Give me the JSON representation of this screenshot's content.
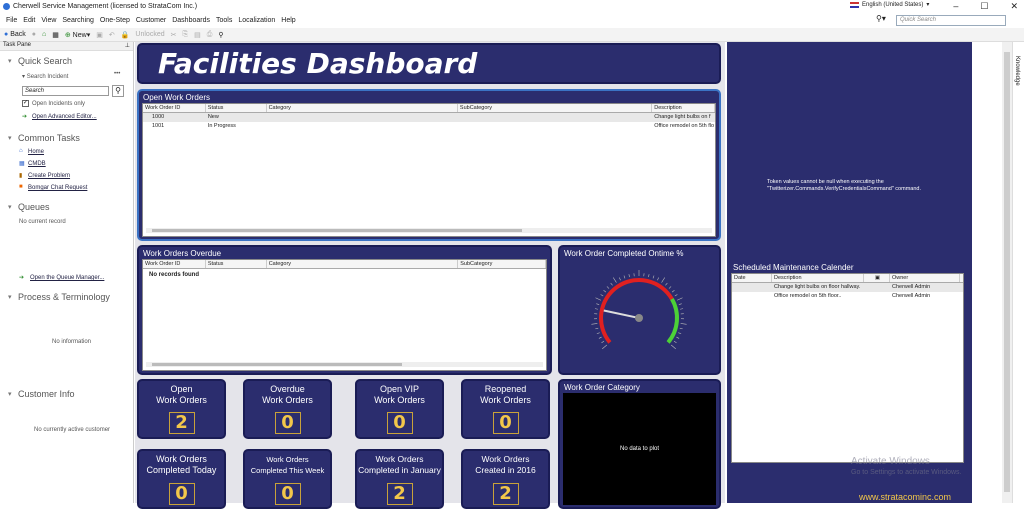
{
  "window": {
    "title": "Cherwell Service Management (licensed to StrataCom Inc.)",
    "minimize": "–",
    "maximize": "☐",
    "close": "✕",
    "language": "English (United States)"
  },
  "menu": [
    "File",
    "Edit",
    "View",
    "Searching",
    "One-Step",
    "Customer",
    "Dashboards",
    "Tools",
    "Localization",
    "Help"
  ],
  "quick_search": {
    "placeholder": "Quick Search"
  },
  "toolbar": {
    "back": "Back",
    "new": "New",
    "unlocked": "Unlocked"
  },
  "task_pane": {
    "title": "Task Pane",
    "quick_search": {
      "title": "Quick Search",
      "label": "Search Incident",
      "placeholder": "Search",
      "open_only": "Open Incidents only",
      "advanced": "Open Advanced Editor..."
    },
    "common_tasks": {
      "title": "Common Tasks",
      "items": [
        "Home",
        "CMDB",
        "Create Problem",
        "Bomgar Chat Request"
      ]
    },
    "queues": {
      "title": "Queues",
      "empty": "No current record",
      "manager": "Open the Queue Manager..."
    },
    "process": {
      "title": "Process & Terminology",
      "empty": "No information"
    },
    "customer": {
      "title": "Customer Info",
      "empty": "No currently active customer"
    }
  },
  "dashboard": {
    "title": "Facilities Dashboard",
    "open_work_orders": {
      "title": "Open Work Orders",
      "columns": [
        "Work Order ID",
        "Status",
        "Category",
        "SubCategory",
        "Description"
      ],
      "rows": [
        [
          "1000",
          "New",
          "",
          "",
          "Change light bulbs on f"
        ],
        [
          "1001",
          "In Progress",
          "",
          "",
          "Office remodel on 5th flo"
        ]
      ]
    },
    "overdue": {
      "title": "Work Orders Overdue",
      "columns": [
        "Work Order ID",
        "Status",
        "Category",
        "SubCategory"
      ],
      "empty": "No records found"
    },
    "gauge": {
      "title": "Work Order Completed Ontime %",
      "value_fraction": 0.2
    },
    "category": {
      "title": "Work Order Category",
      "empty": "No data to plot"
    },
    "tiles": [
      {
        "label": "Open\nWork Orders",
        "value": "2"
      },
      {
        "label": "Overdue\nWork Orders",
        "value": "0"
      },
      {
        "label": "Open VIP\nWork Orders",
        "value": "0"
      },
      {
        "label": "Reopened\nWork Orders",
        "value": "0"
      },
      {
        "label": "Work Orders\nCompleted Today",
        "value": "0"
      },
      {
        "label": "Work Orders\nCompleted This Week",
        "value": "0"
      },
      {
        "label": "Work Orders\nCompleted in January",
        "value": "2"
      },
      {
        "label": "Work Orders\nCreated in 2016",
        "value": "2"
      }
    ],
    "twitter_error": "Token values cannot be null when executing the \"Twitterizer.Commands.VerifyCredentialsCommand\" command.",
    "maintenance": {
      "title": "Scheduled Maintenance Calender",
      "columns": [
        "Date",
        "Description",
        "",
        "Owner"
      ],
      "rows": [
        [
          "",
          "Change light bulbs on floor hallway.",
          "",
          "Cherwell Admin"
        ],
        [
          "",
          "Office remodel on 5th floor..",
          "",
          "Cherwell Admin"
        ]
      ]
    },
    "footer_url": "www.stratacominc.com"
  },
  "watermark": {
    "line1": "Activate Windows",
    "line2": "Go to Settings to activate Windows."
  },
  "side_tab": "Knowledge",
  "colors": {
    "panel": "#2b2d6e",
    "accent": "#f3c74a",
    "gauge_red": "#e02020",
    "gauge_green": "#4cd137"
  }
}
